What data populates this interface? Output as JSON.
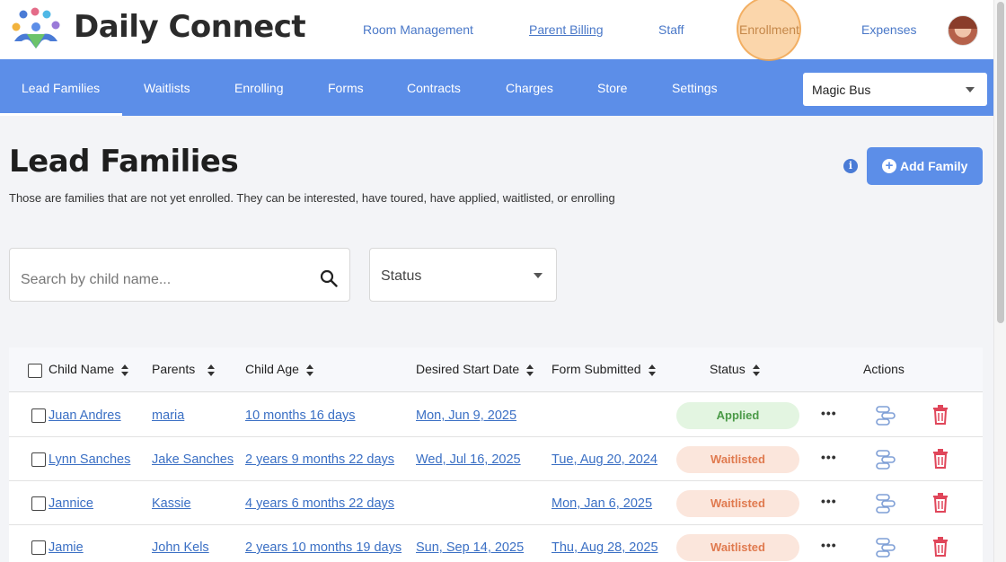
{
  "app": {
    "brand": "Daily Connect",
    "top_nav": [
      "Room Management",
      "Parent Billing",
      "Staff",
      "Enrollment",
      "Expenses"
    ]
  },
  "sub_nav": {
    "tabs": [
      "Lead Families",
      "Waitlists",
      "Enrolling",
      "Forms",
      "Contracts",
      "Charges",
      "Store",
      "Settings"
    ],
    "active_tab": "Lead Families",
    "school_selector": "Magic Bus"
  },
  "page": {
    "title": "Lead Families",
    "subtitle": "Those are families that are not yet enrolled. They can be interested, have toured, have applied, waitlisted, or enrolling",
    "add_button": "Add Family",
    "info_icon": "i"
  },
  "filters": {
    "search_placeholder": "Search by child name...",
    "status_label": "Status"
  },
  "table": {
    "headers": [
      "Child Name",
      "Parents",
      "Child Age",
      "Desired Start Date",
      "Form Submitted",
      "Status",
      "Actions"
    ],
    "rows": [
      {
        "child": "Juan Andres",
        "parents": "maria",
        "age": "10 months 16 days",
        "start": "Mon, Jun 9, 2025",
        "submitted": "",
        "status": "Applied",
        "actions": "•••"
      },
      {
        "child": "Lynn Sanches",
        "parents": "Jake Sanches",
        "age": "2 years 9 months 22 days",
        "start": "Wed, Jul 16, 2025",
        "submitted": "Tue, Aug 20, 2024",
        "status": "Waitlisted",
        "actions": "•••"
      },
      {
        "child": "Jannice",
        "parents": "Kassie",
        "age": "4 years 6 months 22 days",
        "start": "",
        "submitted": "Mon, Jan 6, 2025",
        "status": "Waitlisted",
        "actions": "•••"
      },
      {
        "child": "Jamie",
        "parents": "John Kels",
        "age": "2 years 10 months 19 days",
        "start": "Sun, Sep 14, 2025",
        "submitted": "Thu, Aug 28, 2025",
        "status": "Waitlisted",
        "actions": "•••"
      }
    ]
  },
  "colors": {
    "accent": "#5c8ee8",
    "link": "#3a6fc4",
    "applied_bg": "#e3f5e1",
    "waitlisted_bg": "#fbe6dc",
    "trash": "#e0465a"
  },
  "icons": [
    "logo-icon",
    "avatar",
    "chevron-down-icon",
    "info-icon",
    "plus-circle-icon",
    "search-icon",
    "sort-icon",
    "link-icon",
    "trash-icon",
    "more-icon"
  ]
}
